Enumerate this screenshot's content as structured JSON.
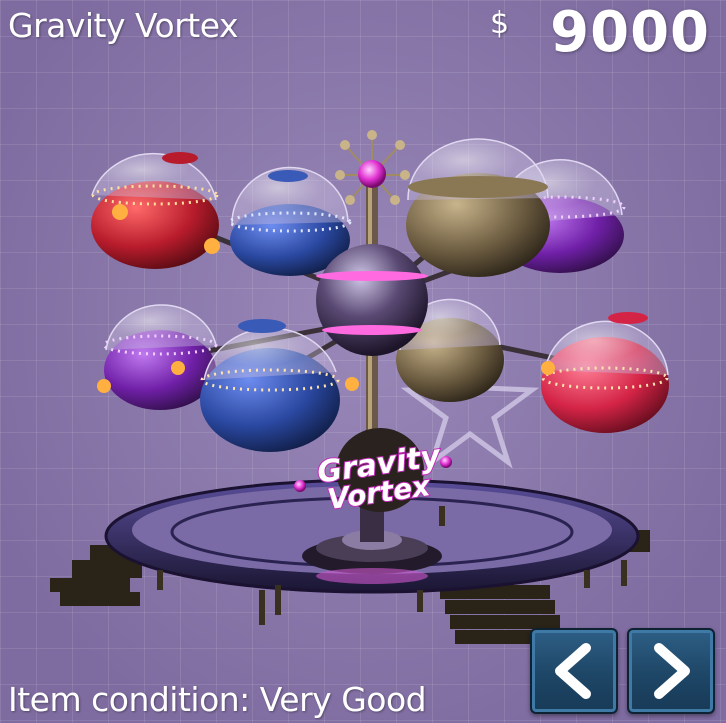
{
  "item": {
    "name": "Gravity Vortex",
    "currency_symbol": "$",
    "price": "9000",
    "condition": "Item condition: Very Good",
    "sign_line1": "Gravity",
    "sign_line2": "Vortex"
  },
  "navigation": {
    "prev_icon": "chevron-left-icon",
    "next_icon": "chevron-right-icon"
  },
  "colors": {
    "background": "#8a78aa",
    "button": "#1e4666",
    "pod_red": "#c0283a",
    "pod_blue": "#2f4fa8",
    "pod_purple": "#7a2cb0",
    "pod_bronze": "#7a6a4c",
    "pod_pink": "#d8304e"
  }
}
